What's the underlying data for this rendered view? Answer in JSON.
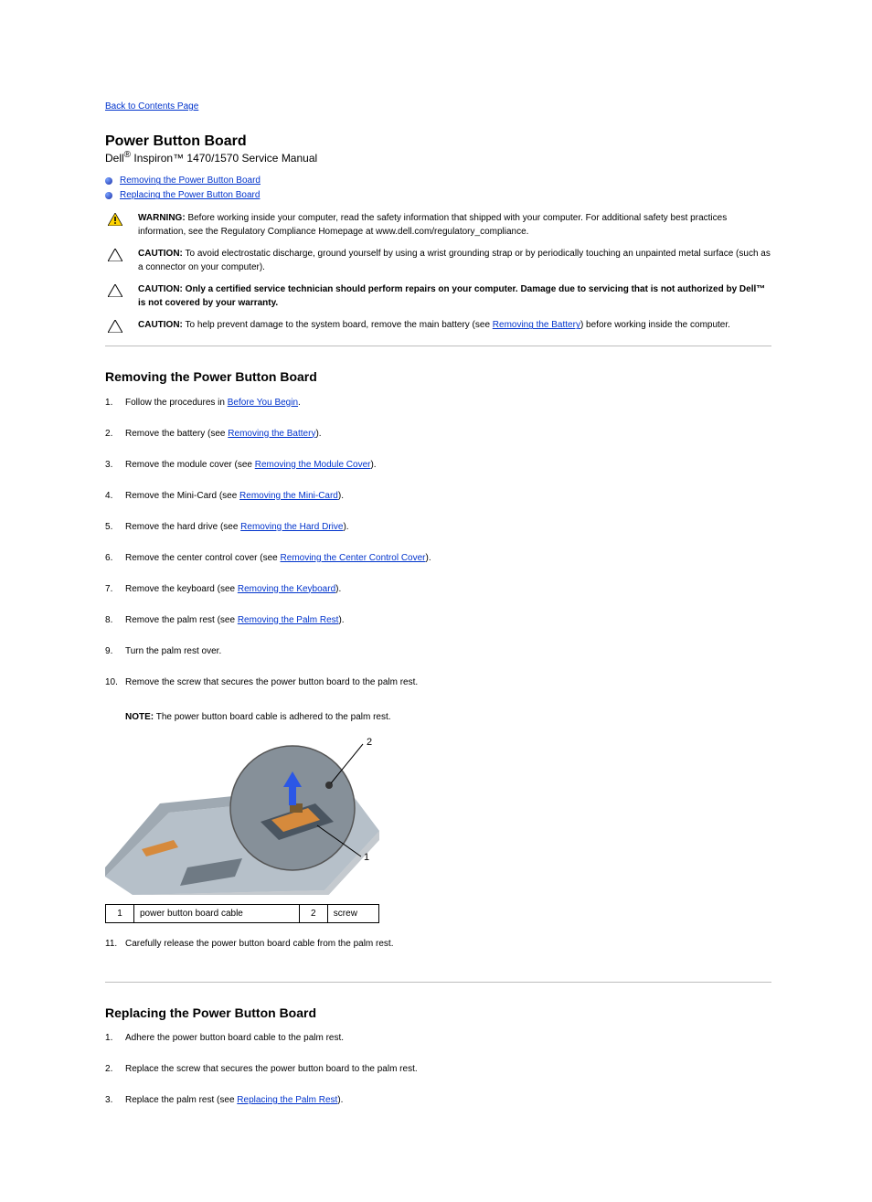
{
  "back_link": "Back to Contents Page",
  "title": {
    "line1": "Power Button Board",
    "line2_prefix": "Dell",
    "line2_suffix": " Inspiron™ 1470/1570 Service Manual"
  },
  "toc": [
    "Removing the Power Button Board",
    "Replacing the Power Button Board"
  ],
  "notices": {
    "warning_label": "WARNING:",
    "warning_text": " Before working inside your computer, read the safety information that shipped with your computer. For additional safety best practices information, see the Regulatory Compliance Homepage at www.dell.com/regulatory_compliance.",
    "caution1_label": "CAUTION:",
    "caution1_text": " To avoid electrostatic discharge, ground yourself by using a wrist grounding strap or by periodically touching an unpainted metal surface (such as a connector on your computer).",
    "caution2_label": "CAUTION:",
    "caution2_text_pre": " Only a certified service technician should perform repairs on your computer. Damage due to servicing that is not authorized by Dell",
    "caution2_text_post": " is not covered by your warranty.",
    "caution3_label": "CAUTION:",
    "caution3_text_pre": " To help prevent damage to the system board, remove the main battery (see ",
    "caution3_link": "Removing the Battery",
    "caution3_text_post": ") before working inside the computer."
  },
  "section1": {
    "heading": "Removing the Power Button Board",
    "steps": [
      {
        "pre": "Follow the procedures in ",
        "link": "Before You Begin",
        "post": "."
      },
      {
        "pre": "Remove the battery (see ",
        "link": "Removing the Battery",
        "post": ")."
      },
      {
        "pre": "Remove the module cover (see ",
        "link": "Removing the Module Cover",
        "post": ")."
      },
      {
        "pre": "Remove the Mini-Card (see ",
        "link": "Removing the Mini-Card",
        "post": ")."
      },
      {
        "pre": "Remove the hard drive (see ",
        "link": "Removing the Hard Drive",
        "post": ")."
      },
      {
        "pre": "Remove the center control cover (see ",
        "link": "Removing the Center Control Cover",
        "post": ")."
      },
      {
        "pre": "Remove the keyboard (see ",
        "link": "Removing the Keyboard",
        "post": ")."
      },
      {
        "pre": "Remove the palm rest (see ",
        "link": "Removing the Palm Rest",
        "post": ")."
      },
      {
        "pre": "Turn the palm rest over.",
        "link": "",
        "post": ""
      },
      {
        "pre": "Remove the screw that secures the power button board to the palm rest.",
        "link": "",
        "post": ""
      }
    ],
    "note_label": "NOTE:",
    "note_text": " The power button board cable is adhered to the palm rest.",
    "callouts": {
      "c1": {
        "num": "1",
        "label": "power button board cable"
      },
      "c2": {
        "num": "2",
        "label": "screw"
      }
    },
    "trailing": [
      "Carefully release the power button board cable from the palm rest."
    ]
  },
  "section2": {
    "heading": "Replacing the Power Button Board",
    "steps": [
      {
        "pre": "Adhere the power button board cable to the palm rest.",
        "link": "",
        "post": ""
      },
      {
        "pre": "Replace the screw that secures the power button board to the palm rest.",
        "link": "",
        "post": ""
      },
      {
        "pre": "Replace the palm rest (see ",
        "link": "Replacing the Palm Rest",
        "post": ")."
      }
    ]
  }
}
